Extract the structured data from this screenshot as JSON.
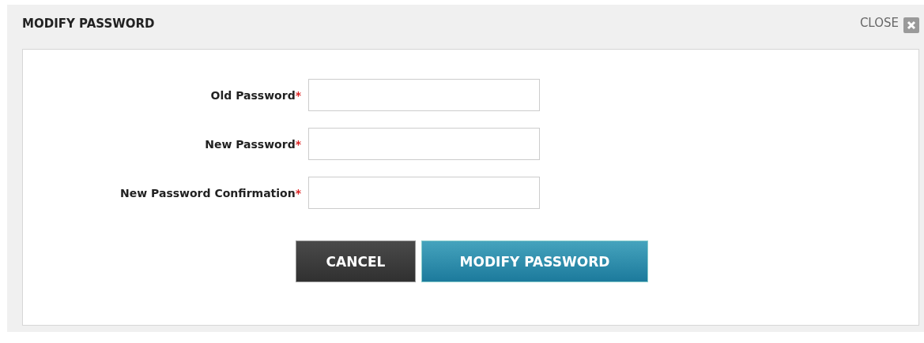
{
  "dialog": {
    "title": "MODIFY PASSWORD",
    "close_label": "CLOSE"
  },
  "fields": [
    {
      "label": "Old Password",
      "required_mark": "*"
    },
    {
      "label": "New Password",
      "required_mark": "*"
    },
    {
      "label": "New Password Confirmation",
      "required_mark": "*"
    }
  ],
  "buttons": [
    {
      "label": "CANCEL",
      "kind": "secondary"
    },
    {
      "label": "MODIFY PASSWORD",
      "kind": "primary"
    }
  ]
}
